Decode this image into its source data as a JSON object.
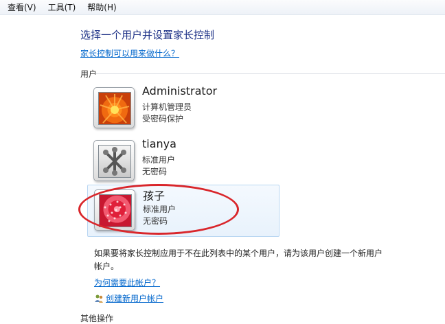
{
  "menubar": {
    "items": [
      {
        "label": "查看(V)"
      },
      {
        "label": "工具(T)"
      },
      {
        "label": "帮助(H)"
      }
    ]
  },
  "page": {
    "title": "选择一个用户并设置家长控制",
    "help_link": "家长控制可以用来做什么？",
    "users_section": "用户",
    "other_section": "其他操作"
  },
  "users": [
    {
      "name": "Administrator",
      "type": "计算机管理员",
      "password": "受密码保护",
      "avatar": "orange-flower-picture"
    },
    {
      "name": "tianya",
      "type": "标准用户",
      "password": "无密码",
      "avatar": "jacks-picture"
    },
    {
      "name": "孩子",
      "type": "标准用户",
      "password": "无密码",
      "avatar": "starfish-picture",
      "selected": true
    }
  ],
  "annotation": {
    "color": "#d9262b"
  },
  "note": "如果要将家长控制应用于不在此列表中的某个用户，请为该用户创建一个新用户帐户。",
  "links": {
    "why": "为何需要此帐户？",
    "create": "创建新用户帐户"
  },
  "colors": {
    "title": "#1e3287",
    "link": "#0066cc",
    "selected_border": "#b8d6f2"
  }
}
